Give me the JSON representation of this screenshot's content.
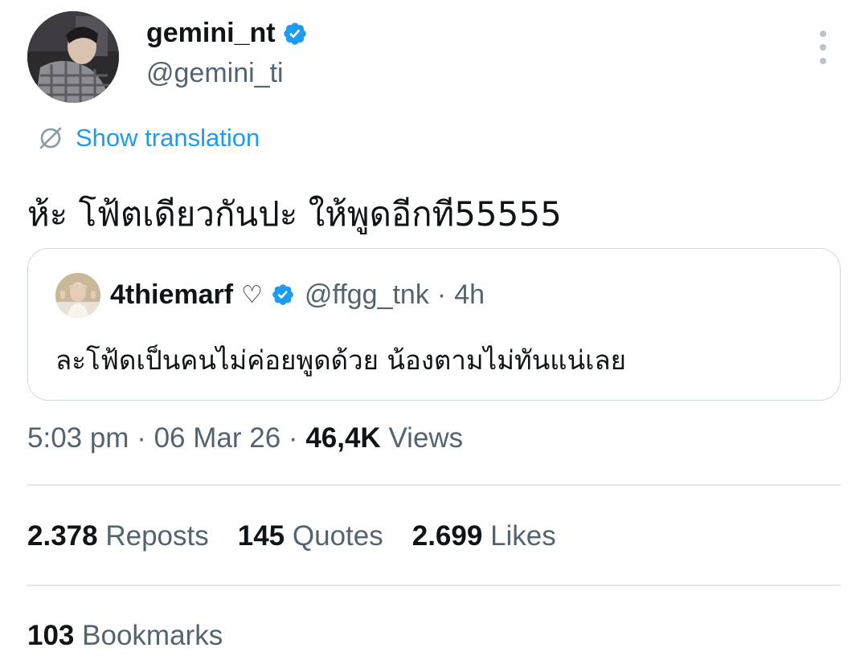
{
  "author": {
    "name": "gemini_nt",
    "handle": "@gemini_ti",
    "verified": true
  },
  "translate": {
    "label": "Show translation"
  },
  "tweet": {
    "text": "ห้ะ โฟ้ตเดียวกันปะ ให้พูดอีกที55555"
  },
  "quote": {
    "name": "4thiemarf",
    "heart": "♡",
    "handle": "@ffgg_tnk",
    "separator": "·",
    "time": "4h",
    "text": "ละโฟ้ดเป็นคนไม่ค่อยพูดด้วย น้องตามไม่ทันแน่เลย"
  },
  "meta": {
    "time": "5:03 pm",
    "date": "06 Mar 26",
    "views_count": "46,4K",
    "views_label": "Views",
    "separator": "·"
  },
  "stats": {
    "reposts": {
      "count": "2.378",
      "label": "Reposts"
    },
    "quotes": {
      "count": "145",
      "label": "Quotes"
    },
    "likes": {
      "count": "2.699",
      "label": "Likes"
    },
    "bookmarks": {
      "count": "103",
      "label": "Bookmarks"
    }
  },
  "icons": {
    "verified": "verified-badge-icon",
    "more": "more-options-icon",
    "translate": "globe-translate-icon"
  },
  "colors": {
    "accent": "#1d9bf0",
    "secondary_text": "#536471",
    "primary_text": "#0f1419",
    "border": "#cfd9de"
  }
}
